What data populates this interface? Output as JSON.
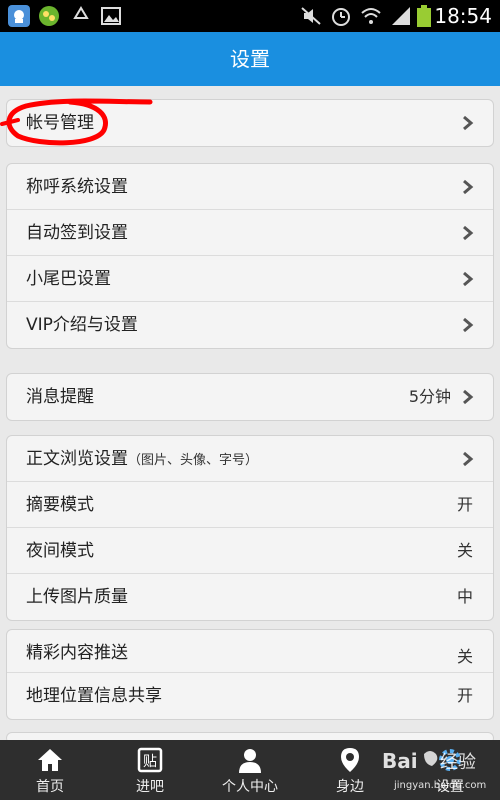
{
  "status_bar": {
    "time": "18:54",
    "icons": [
      "qq-icon",
      "wechat-icon",
      "recycle-icon",
      "gallery-icon",
      "mute-icon",
      "alarm-icon",
      "wifi-icon",
      "signal-icon",
      "battery-icon"
    ]
  },
  "header": {
    "title": "设置"
  },
  "groups": [
    {
      "rows": [
        {
          "label": "帐号管理",
          "chevron": true
        }
      ]
    },
    {
      "rows": [
        {
          "label": "称呼系统设置",
          "chevron": true
        },
        {
          "label": "自动签到设置",
          "chevron": true
        },
        {
          "label": "小尾巴设置",
          "chevron": true
        },
        {
          "label": "VIP介绍与设置",
          "chevron": true
        }
      ]
    },
    {
      "rows": [
        {
          "label": "消息提醒",
          "value": "5分钟",
          "chevron": true
        }
      ]
    },
    {
      "rows": [
        {
          "label": "正文浏览设置",
          "sub": "（图片、头像、字号）",
          "chevron": true
        },
        {
          "label": "摘要模式",
          "value": "开"
        },
        {
          "label": "夜间模式",
          "value": "关"
        },
        {
          "label": "上传图片质量",
          "value": "中"
        }
      ]
    },
    {
      "rows": [
        {
          "label": "精彩内容推送",
          "value": "关"
        },
        {
          "label": "地理位置信息共享",
          "value": "开"
        }
      ]
    }
  ],
  "bottom_nav": [
    {
      "label": "首页",
      "icon": "home-icon"
    },
    {
      "label": "进吧",
      "icon": "tieba-icon"
    },
    {
      "label": "个人中心",
      "icon": "person-icon"
    },
    {
      "label": "身边",
      "icon": "location-icon"
    },
    {
      "label": "设置",
      "icon": "settings-icon"
    }
  ],
  "watermark": {
    "brand": "Bai 经验",
    "url": "jingyan.baidu.com"
  },
  "colors": {
    "header": "#1a8fe0",
    "annotation": "#ff0000",
    "nav_bg": "#2e2e2e"
  }
}
